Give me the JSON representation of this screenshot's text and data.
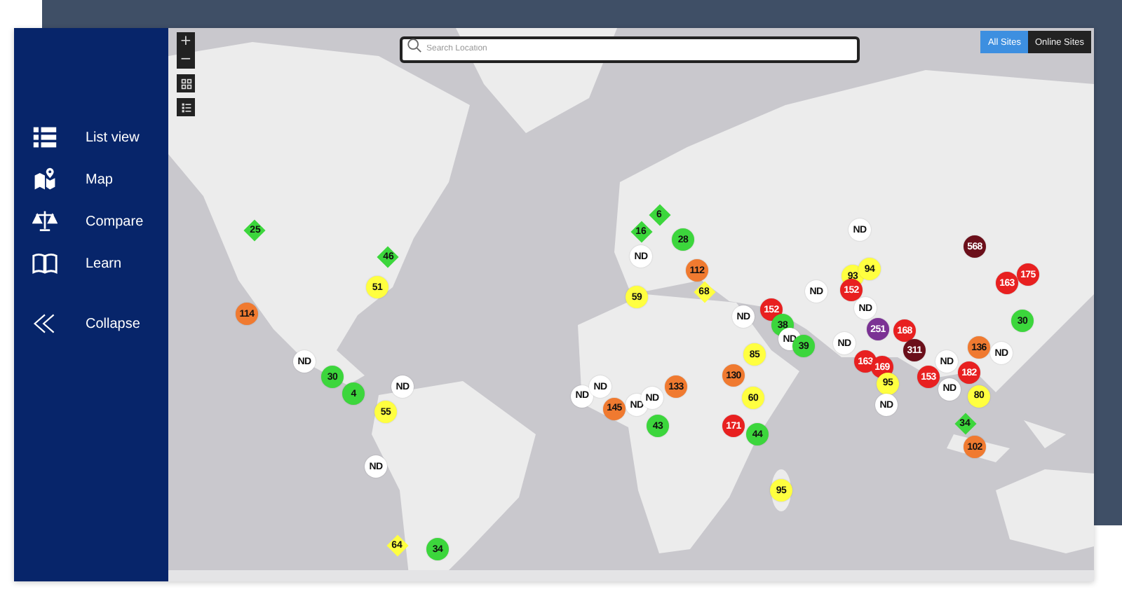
{
  "sidebar": {
    "items": [
      {
        "label": "List view"
      },
      {
        "label": "Map"
      },
      {
        "label": "Compare"
      },
      {
        "label": "Learn"
      },
      {
        "label": "Collapse"
      }
    ]
  },
  "map": {
    "zoom_controls": [
      "+",
      "−"
    ],
    "search": {
      "placeholder": "Search Location"
    },
    "filters": [
      {
        "label": "All Sites",
        "selected": true
      },
      {
        "label": "Online Sites",
        "selected": false
      }
    ],
    "markers": [
      {
        "label": "25",
        "kind": "diamond",
        "color": "#3cd63c"
      },
      {
        "label": "46",
        "kind": "diamond",
        "color": "#3cd63c"
      },
      {
        "label": "51",
        "kind": "circle",
        "color": "#ffff40"
      },
      {
        "label": "114",
        "kind": "circle",
        "color": "#f07a30"
      },
      {
        "label": "ND",
        "kind": "circle",
        "color": "#ffffff"
      },
      {
        "label": "30",
        "kind": "circle",
        "color": "#3cd63c"
      },
      {
        "label": "4",
        "kind": "circle",
        "color": "#3cd63c"
      },
      {
        "label": "ND",
        "kind": "circle",
        "color": "#ffffff"
      },
      {
        "label": "55",
        "kind": "circle",
        "color": "#ffff40"
      },
      {
        "label": "ND",
        "kind": "circle",
        "color": "#ffffff"
      },
      {
        "label": "64",
        "kind": "diamond",
        "color": "#ffff40"
      },
      {
        "label": "34",
        "kind": "circle",
        "color": "#3cd63c"
      },
      {
        "label": "6",
        "kind": "diamond",
        "color": "#3cd63c"
      },
      {
        "label": "16",
        "kind": "diamond",
        "color": "#3cd63c"
      },
      {
        "label": "ND",
        "kind": "circle",
        "color": "#ffffff"
      },
      {
        "label": "59",
        "kind": "circle",
        "color": "#ffff40"
      },
      {
        "label": "28",
        "kind": "circle",
        "color": "#3cd63c"
      },
      {
        "label": "112",
        "kind": "circle",
        "color": "#f07a30"
      },
      {
        "label": "68",
        "kind": "diamond",
        "color": "#ffff40"
      },
      {
        "label": "ND",
        "kind": "circle",
        "color": "#ffffff"
      },
      {
        "label": "ND",
        "kind": "circle",
        "color": "#ffffff"
      },
      {
        "label": "152",
        "kind": "circle",
        "color": "#e82020"
      },
      {
        "label": "38",
        "kind": "circle",
        "color": "#3cd63c"
      },
      {
        "label": "ND",
        "kind": "circle",
        "color": "#ffffff"
      },
      {
        "label": "39",
        "kind": "circle",
        "color": "#3cd63c"
      },
      {
        "label": "85",
        "kind": "circle",
        "color": "#ffff40"
      },
      {
        "label": "130",
        "kind": "circle",
        "color": "#f07a30"
      },
      {
        "label": "133",
        "kind": "circle",
        "color": "#f07a30"
      },
      {
        "label": "60",
        "kind": "circle",
        "color": "#ffff40"
      },
      {
        "label": "171",
        "kind": "circle",
        "color": "#e82020"
      },
      {
        "label": "44",
        "kind": "circle",
        "color": "#3cd63c"
      },
      {
        "label": "43",
        "kind": "circle",
        "color": "#3cd63c"
      },
      {
        "label": "145",
        "kind": "circle",
        "color": "#f07a30"
      },
      {
        "label": "ND",
        "kind": "circle",
        "color": "#ffffff"
      },
      {
        "label": "ND",
        "kind": "circle",
        "color": "#ffffff"
      },
      {
        "label": "ND",
        "kind": "circle",
        "color": "#ffffff"
      },
      {
        "label": "ND",
        "kind": "circle",
        "color": "#ffffff"
      },
      {
        "label": "95",
        "kind": "circle",
        "color": "#ffff40"
      },
      {
        "label": "ND",
        "kind": "circle",
        "color": "#ffffff"
      },
      {
        "label": "93",
        "kind": "circle",
        "color": "#ffff40"
      },
      {
        "label": "94",
        "kind": "circle",
        "color": "#ffff40"
      },
      {
        "label": "152",
        "kind": "circle",
        "color": "#e82020"
      },
      {
        "label": "568",
        "kind": "circle",
        "color": "#6b0f1a"
      },
      {
        "label": "163",
        "kind": "circle",
        "color": "#e82020"
      },
      {
        "label": "175",
        "kind": "circle",
        "color": "#e82020"
      },
      {
        "label": "251",
        "kind": "circle",
        "color": "#7b3294"
      },
      {
        "label": "ND",
        "kind": "circle",
        "color": "#ffffff"
      },
      {
        "label": "168",
        "kind": "circle",
        "color": "#e82020"
      },
      {
        "label": "ND",
        "kind": "circle",
        "color": "#ffffff"
      },
      {
        "label": "311",
        "kind": "circle",
        "color": "#6b0f1a"
      },
      {
        "label": "30",
        "kind": "circle",
        "color": "#3cd63c"
      },
      {
        "label": "136",
        "kind": "circle",
        "color": "#f07a30"
      },
      {
        "label": "ND",
        "kind": "circle",
        "color": "#ffffff"
      },
      {
        "label": "163",
        "kind": "circle",
        "color": "#e82020"
      },
      {
        "label": "169",
        "kind": "circle",
        "color": "#e82020"
      },
      {
        "label": "95",
        "kind": "circle",
        "color": "#ffff40"
      },
      {
        "label": "ND",
        "kind": "circle",
        "color": "#ffffff"
      },
      {
        "label": "153",
        "kind": "circle",
        "color": "#e82020"
      },
      {
        "label": "182",
        "kind": "circle",
        "color": "#e82020"
      },
      {
        "label": "ND",
        "kind": "circle",
        "color": "#ffffff"
      },
      {
        "label": "ND",
        "kind": "circle",
        "color": "#ffffff"
      },
      {
        "label": "80",
        "kind": "circle",
        "color": "#ffff40"
      },
      {
        "label": "34",
        "kind": "diamond",
        "color": "#3cd63c"
      },
      {
        "label": "102",
        "kind": "circle",
        "color": "#f07a30"
      }
    ]
  }
}
